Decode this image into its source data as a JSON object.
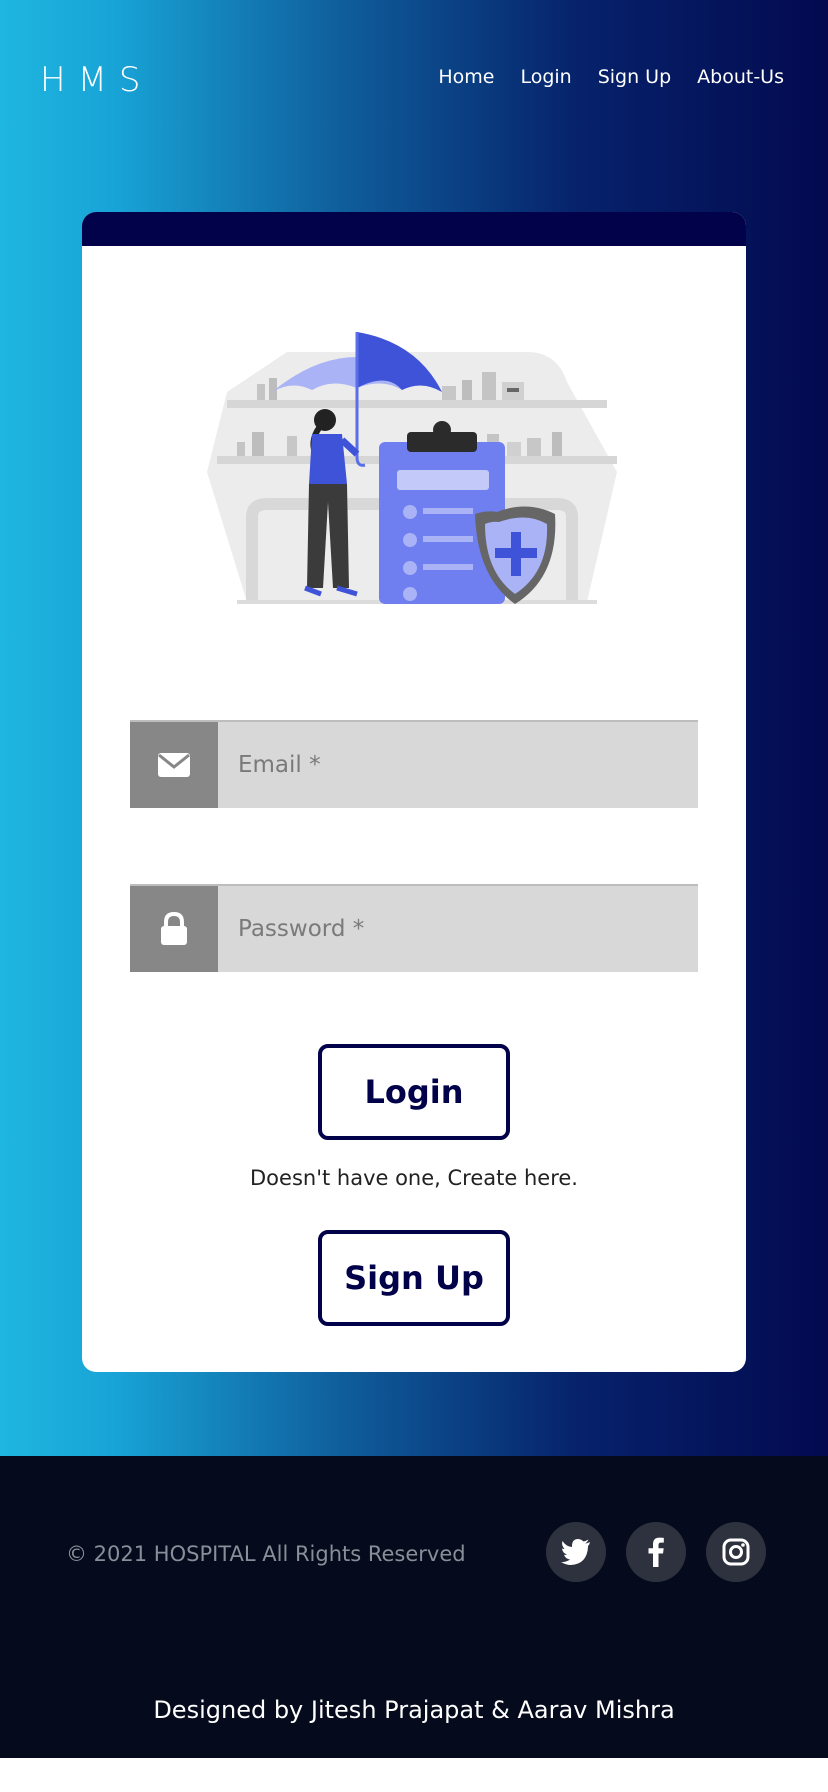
{
  "header": {
    "logo": "HMS",
    "nav": [
      "Home",
      "Login",
      "Sign Up",
      "About-Us"
    ]
  },
  "login": {
    "email_placeholder": "Email *",
    "password_placeholder": "Password *",
    "login_label": "Login",
    "create_text": "Doesn't have one, Create here.",
    "signup_label": "Sign Up"
  },
  "footer": {
    "copyright": "© 2021 HOSPITAL All Rights Reserved",
    "social": [
      "twitter-icon",
      "facebook-icon",
      "instagram-icon"
    ],
    "designed_by": "Designed by Jitesh Prajapat & Aarav Mishra"
  },
  "colors": {
    "accent": "#02024a",
    "gradient_start": "#1fb6e0",
    "gradient_end": "#030a4f",
    "footer_bg": "#050a1c"
  }
}
